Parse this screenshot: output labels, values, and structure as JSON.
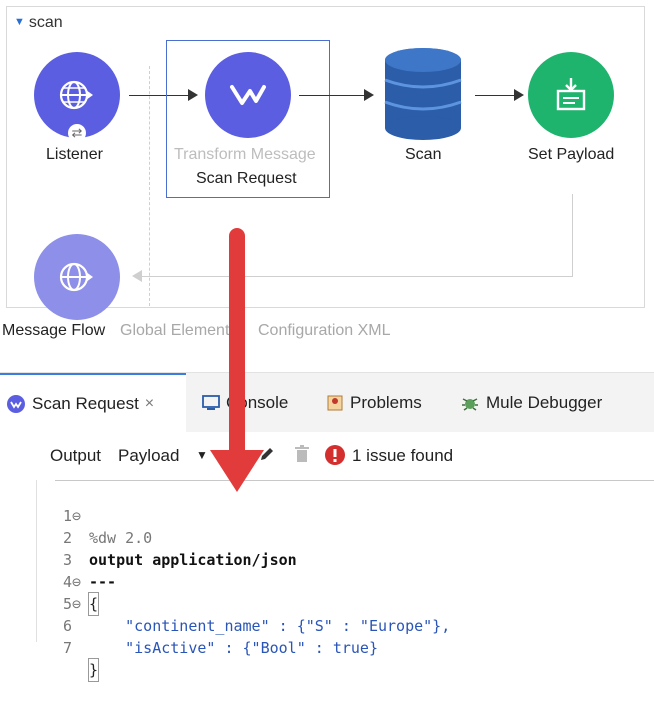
{
  "flow": {
    "name": "scan",
    "nodes": [
      {
        "label": "Listener"
      },
      {
        "label_top": "Transform Message",
        "label": "Scan Request"
      },
      {
        "label": "Scan"
      },
      {
        "label": "Set Payload"
      }
    ]
  },
  "view_tabs": [
    "Message Flow",
    "Global Elements",
    "Configuration XML"
  ],
  "panel": {
    "tabs": [
      {
        "label": "Scan Request",
        "icon": "dataweave-icon",
        "close": "×"
      },
      {
        "label": "Console",
        "icon": "console-icon"
      },
      {
        "label": "Problems",
        "icon": "problems-icon"
      },
      {
        "label": "Mule Debugger",
        "icon": "debugger-icon"
      }
    ],
    "toolbar": {
      "output_label": "Output",
      "target_value": "Payload",
      "issues": "1 issue found"
    }
  },
  "editor": {
    "lines": [
      {
        "n": "1",
        "fold": "⊖",
        "text": "%dw 2.0"
      },
      {
        "n": "2",
        "fold": "",
        "text": "output application/json"
      },
      {
        "n": "3",
        "fold": "",
        "text": "---"
      },
      {
        "n": "4",
        "fold": "⊖",
        "text": "{"
      },
      {
        "n": "5",
        "fold": "⊖",
        "text": "    \"continent_name\" : {\"S\" : \"Europe\"},"
      },
      {
        "n": "6",
        "fold": "",
        "text": "    \"isActive\" : {\"Bool\" : true}"
      },
      {
        "n": "7",
        "fold": "",
        "text": "}"
      }
    ]
  },
  "colors": {
    "accent": "#3b7ddd",
    "purple_node": "#5b5ee0",
    "green_node": "#1fb46d",
    "scan_node": "#2b5da8",
    "annotation": "#e23b3b",
    "issue": "#d32f2f"
  }
}
